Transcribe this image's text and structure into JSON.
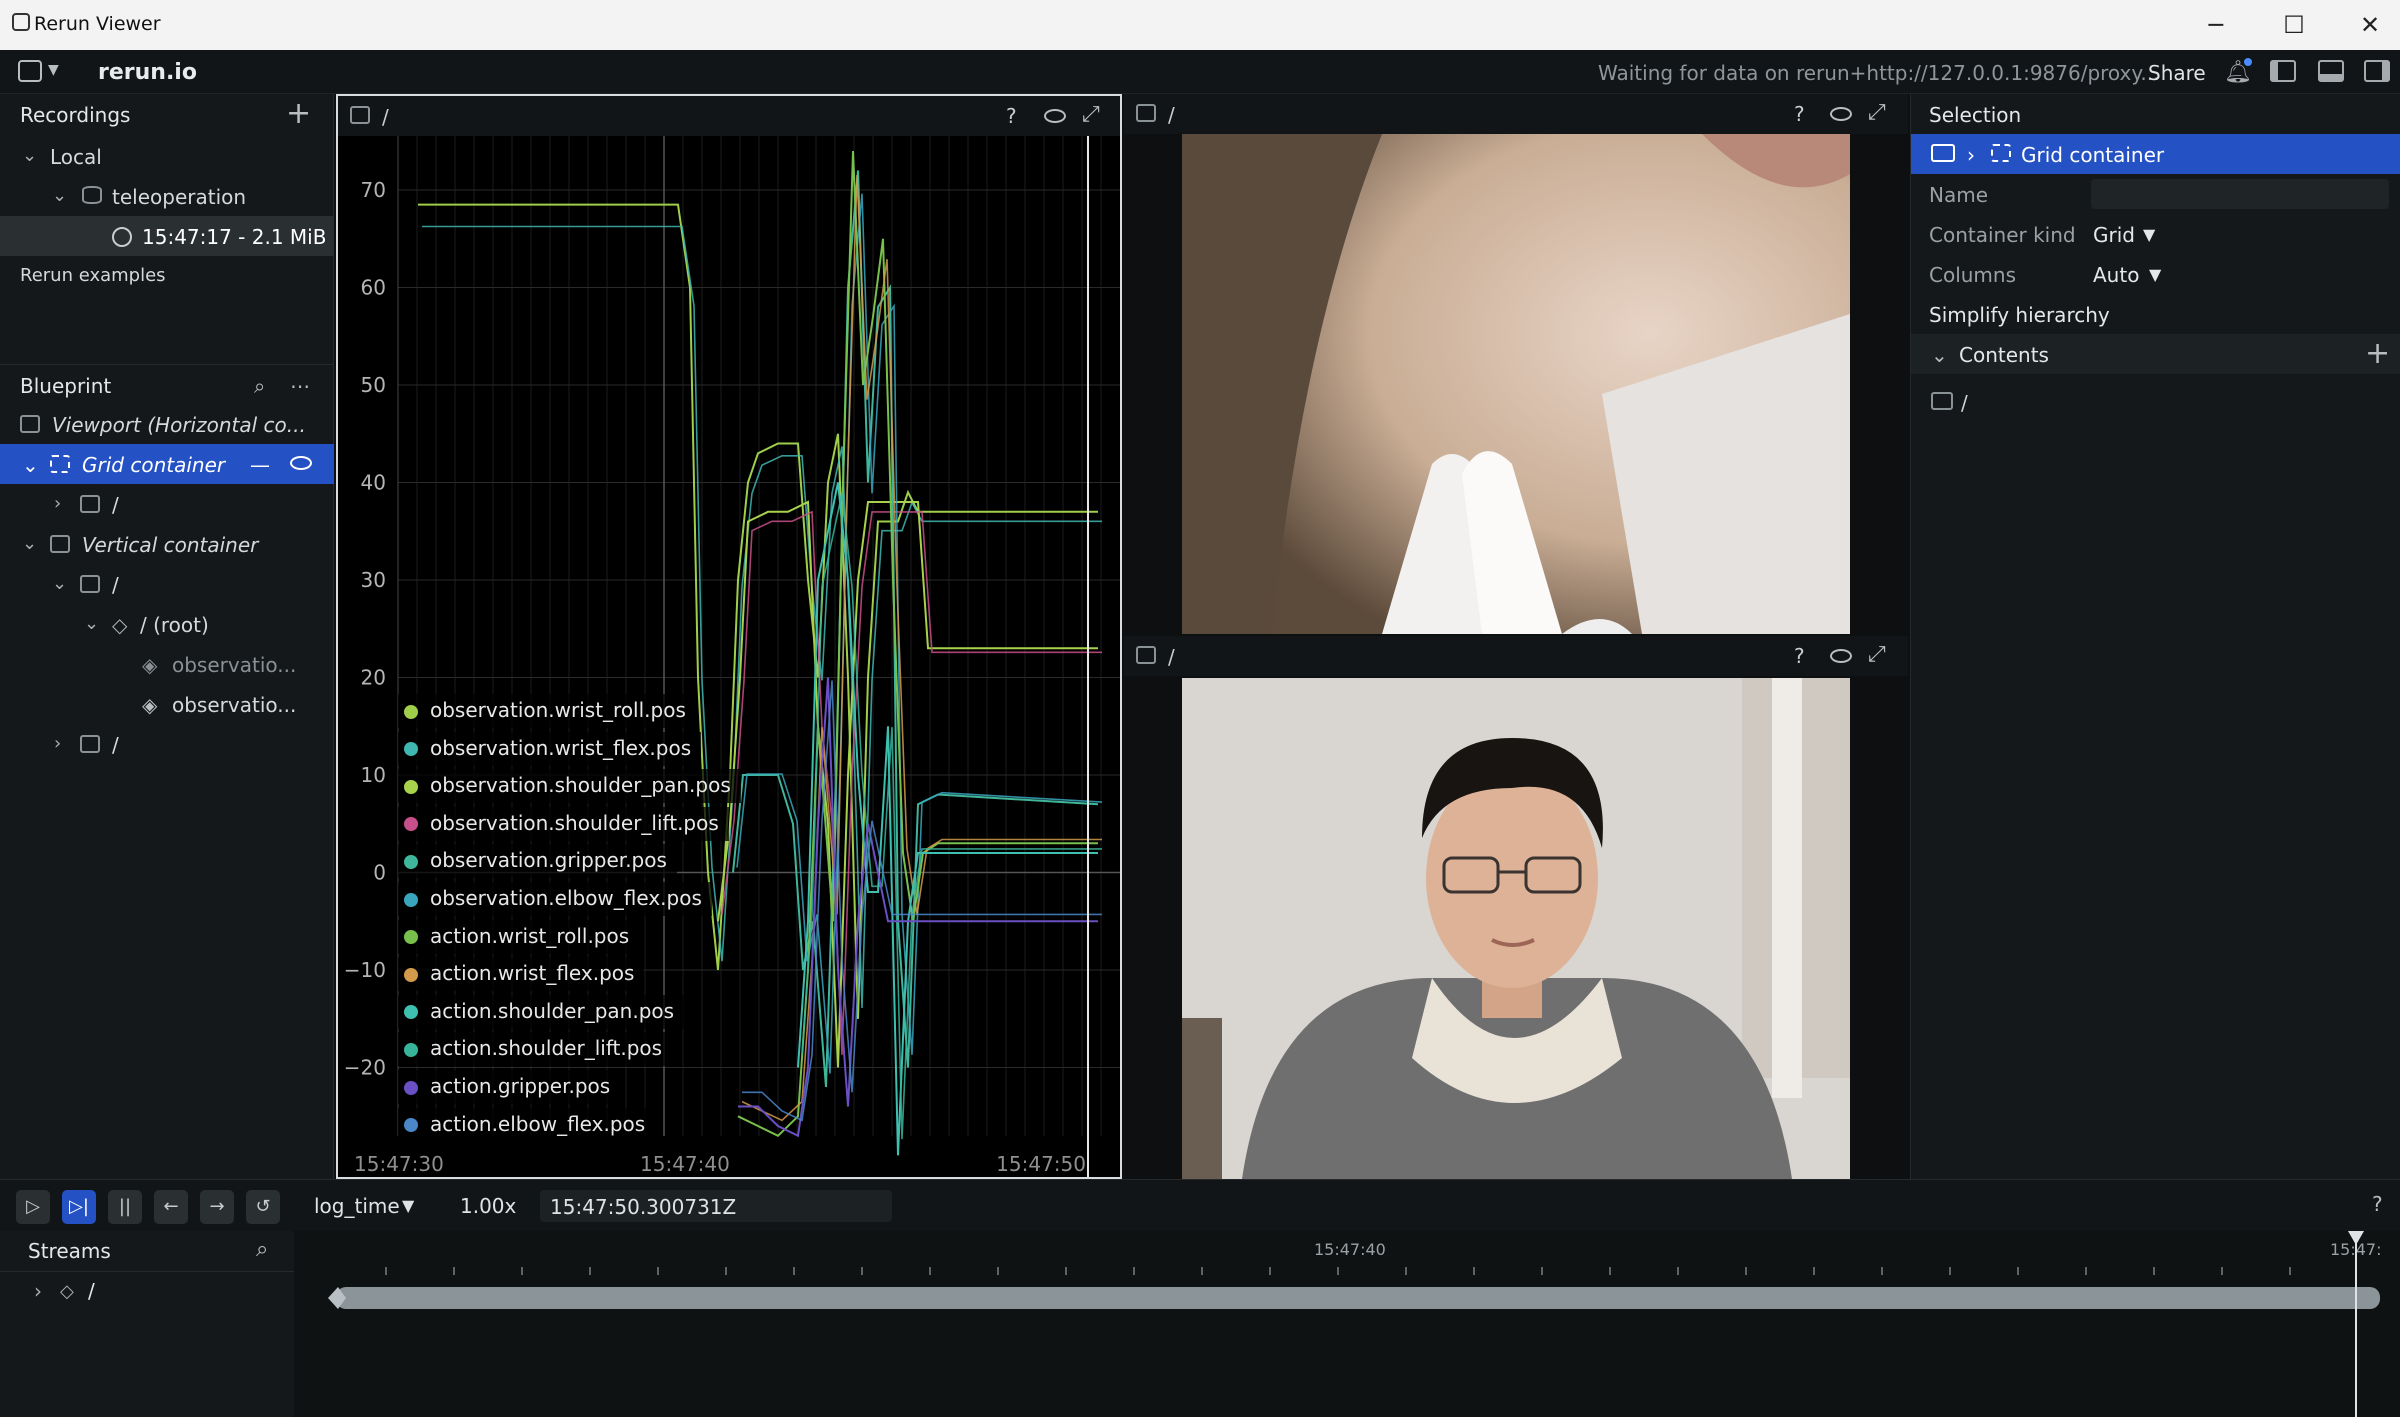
{
  "window": {
    "title": "Rerun Viewer",
    "minimize": "─",
    "maximize": "☐",
    "close": "✕"
  },
  "topbar": {
    "brand": "rerun.io",
    "status": "Waiting for data on rerun+http://127.0.0.1:9876/proxy...",
    "share": "Share"
  },
  "recordings": {
    "header": "Recordings",
    "add": "+",
    "local": "Local",
    "app": "teleoperation",
    "recording": "15:47:17 - 2.1 MiB",
    "examples": "Rerun examples"
  },
  "blueprint": {
    "header": "Blueprint",
    "more": "⋯",
    "viewport": "Viewport (Horizontal co...",
    "grid": "Grid container",
    "grid_child": "/",
    "vertical": "Vertical container",
    "vchild1": "/",
    "root": "/ (root)",
    "obs1": "observatio...",
    "obs2": "observatio...",
    "vchild2": "/"
  },
  "plot": {
    "path": "/",
    "help": "?",
    "yticks": [
      "70",
      "60",
      "50",
      "40",
      "30",
      "20",
      "10",
      "0",
      "−10",
      "−20"
    ],
    "xticks": [
      "15:47:30",
      "15:47:40",
      "15:47:50"
    ],
    "legend": [
      {
        "name": "observation.wrist_roll.pos",
        "color": "#9fcf4a"
      },
      {
        "name": "observation.wrist_flex.pos",
        "color": "#3fb6b0"
      },
      {
        "name": "observation.shoulder_pan.pos",
        "color": "#a8d24c"
      },
      {
        "name": "observation.shoulder_lift.pos",
        "color": "#c94f8a"
      },
      {
        "name": "observation.gripper.pos",
        "color": "#3fb69a"
      },
      {
        "name": "observation.elbow_flex.pos",
        "color": "#3aa6bd"
      },
      {
        "name": "action.wrist_roll.pos",
        "color": "#78c04c"
      },
      {
        "name": "action.wrist_flex.pos",
        "color": "#d39a4b"
      },
      {
        "name": "action.shoulder_pan.pos",
        "color": "#3fbfb0"
      },
      {
        "name": "action.shoulder_lift.pos",
        "color": "#37b59a"
      },
      {
        "name": "action.gripper.pos",
        "color": "#6b4fc4"
      },
      {
        "name": "action.elbow_flex.pos",
        "color": "#4a86c8"
      }
    ]
  },
  "image_views": [
    {
      "path": "/",
      "help": "?"
    },
    {
      "path": "/",
      "help": "?"
    }
  ],
  "selection": {
    "header": "Selection",
    "crumb": "Grid container",
    "name_label": "Name",
    "name_value": "",
    "kind_label": "Container kind",
    "kind_value": "Grid",
    "columns_label": "Columns",
    "columns_value": "Auto",
    "simplify": "Simplify hierarchy",
    "contents": "Contents",
    "content_item": "/"
  },
  "timeline": {
    "timeline_name": "log_time",
    "speed": "1.00x",
    "current": "15:47:50.300731Z",
    "help": "?",
    "tick_label": "15:47:40",
    "tick_label_end": "15:47:",
    "streams": "Streams",
    "stream_root": "/"
  }
}
